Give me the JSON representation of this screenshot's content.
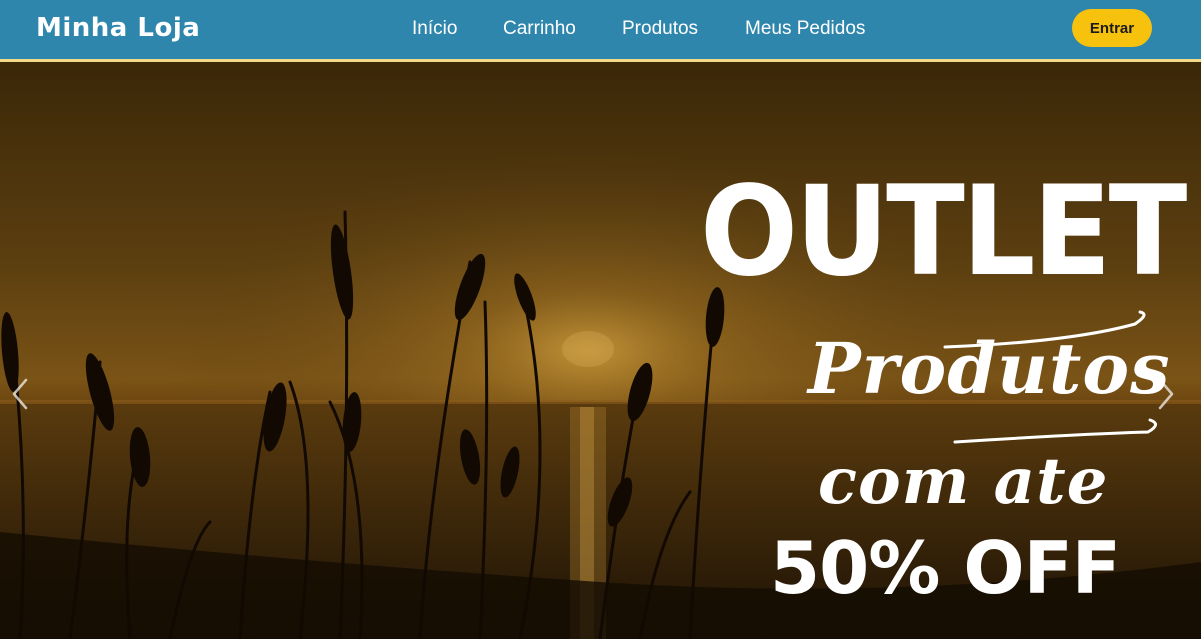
{
  "brand": {
    "name": "Minha Loja"
  },
  "nav": {
    "links": [
      {
        "label": "Início"
      },
      {
        "label": "Carrinho"
      },
      {
        "label": "Produtos"
      },
      {
        "label": "Meus Pedidos"
      }
    ],
    "login_label": "Entrar"
  },
  "banner": {
    "headline": "OUTLET",
    "line1": "Produtos",
    "line2": "com ate",
    "offer": "50% OFF"
  },
  "carousel": {
    "prev_icon": "chevron-left-icon",
    "next_icon": "chevron-right-icon"
  },
  "colors": {
    "navbar": "#2f86ad",
    "navbar_border": "#f2d98a",
    "login_button": "#f7c20d",
    "text_light": "#ffffff"
  }
}
